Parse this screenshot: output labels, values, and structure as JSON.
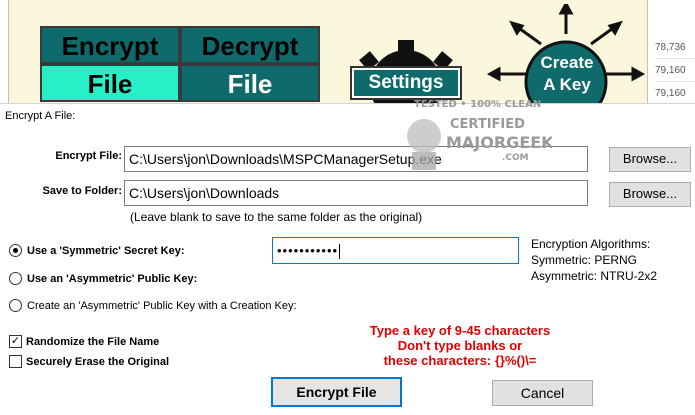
{
  "background_app": {
    "encrypt_tile": {
      "top": "Encrypt",
      "bottom": "File"
    },
    "decrypt_tile": {
      "top": "Decrypt",
      "bottom": "File"
    },
    "settings_label": "Settings",
    "create_key_line1": "Create",
    "create_key_line2": "A Key",
    "side_numbers": [
      "78,736",
      "79,160",
      "79,160"
    ]
  },
  "watermark": {
    "line1": "TESTED • 100% CLEAN",
    "line2": "CERTIFIED",
    "line3": "MAJORGEEKS",
    "line4": ".COM"
  },
  "dialog": {
    "title": "Encrypt A File:",
    "encrypt_file": {
      "label": "Encrypt File:",
      "value": "C:\\Users\\jon\\Downloads\\MSPCManagerSetup.exe",
      "browse_label": "Browse..."
    },
    "save_folder": {
      "label": "Save to Folder:",
      "value": "C:\\Users\\jon\\Downloads",
      "browse_label": "Browse...",
      "hint": "(Leave blank to save to the same folder as the original)"
    },
    "key_options": [
      {
        "label": "Use a 'Symmetric' Secret Key:",
        "checked": true
      },
      {
        "label": "Use an 'Asymmetric' Public Key:",
        "checked": false
      },
      {
        "label": "Create an 'Asymmetric' Public Key with a Creation Key:",
        "checked": false
      }
    ],
    "key_value": "•••••••••••",
    "algorithms": {
      "heading": "Encryption Algorithms:",
      "symmetric": "Symmetric: PERNG",
      "asymmetric": "Asymmetric: NTRU-2x2"
    },
    "checkboxes": [
      {
        "label": "Randomize the File Name",
        "checked": true,
        "mark": "✓"
      },
      {
        "label": "Securely Erase the Original",
        "checked": false,
        "mark": ""
      }
    ],
    "warning": {
      "line1": "Type a key of 9-45 characters",
      "line2": "Don't type blanks or",
      "line3": "these characters: {}%()\\="
    },
    "encrypt_button": "Encrypt File",
    "cancel_button": "Cancel"
  },
  "colors": {
    "tile_teal": "#0f6b6b",
    "tile_highlight": "#27f0c9",
    "canvas_bg": "#fbf7dc",
    "warning_red": "#e00000",
    "focus_blue": "#0078d7"
  }
}
